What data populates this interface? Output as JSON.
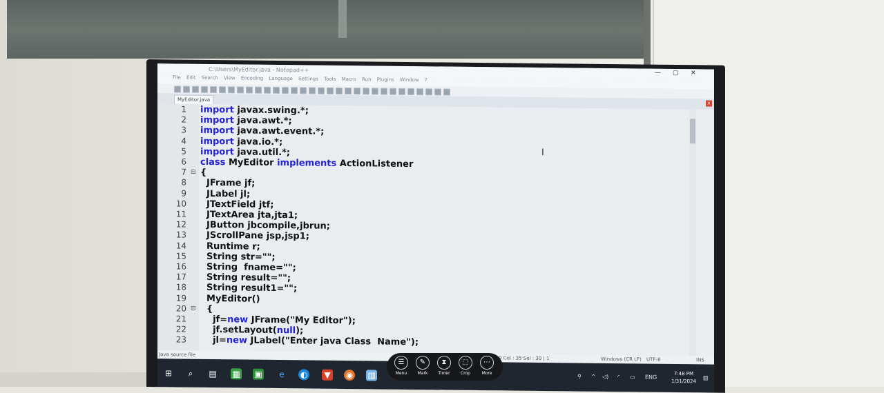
{
  "window": {
    "title": "C:\\Users\\MyEditor.java - Notepad++",
    "controls": [
      "—",
      "▢",
      "✕"
    ]
  },
  "menu": [
    "File",
    "Edit",
    "Search",
    "View",
    "Encoding",
    "Language",
    "Settings",
    "Tools",
    "Macro",
    "Run",
    "Plugins",
    "Window",
    "?"
  ],
  "tab": {
    "label": "MyEditor.java",
    "close": "x"
  },
  "editor": {
    "lines": [
      {
        "n": "1",
        "kw": "import",
        "rest": " javax.swing.*;"
      },
      {
        "n": "2",
        "kw": "import",
        "rest": " java.awt.*;"
      },
      {
        "n": "3",
        "kw": "import",
        "rest": " java.awt.event.*;"
      },
      {
        "n": "4",
        "kw": "import",
        "rest": " java.io.*;"
      },
      {
        "n": "5",
        "kw": "import",
        "rest": " java.util.*;"
      },
      {
        "n": "6",
        "kw": "class",
        "rest": " MyEditor ",
        "kw2": "implements",
        "rest2": " ActionListener"
      },
      {
        "n": "7",
        "kw": "",
        "rest": "{"
      },
      {
        "n": "8",
        "kw": "",
        "rest": "  JFrame jf;"
      },
      {
        "n": "9",
        "kw": "",
        "rest": "  JLabel jl;"
      },
      {
        "n": "10",
        "kw": "",
        "rest": "  JTextField jtf;"
      },
      {
        "n": "11",
        "kw": "",
        "rest": "  JTextArea jta,jta1;"
      },
      {
        "n": "12",
        "kw": "",
        "rest": "  JButton jbcompile,jbrun;"
      },
      {
        "n": "13",
        "kw": "",
        "rest": "  JScrollPane jsp,jsp1;"
      },
      {
        "n": "14",
        "kw": "",
        "rest": "  Runtime r;"
      },
      {
        "n": "15",
        "kw": "",
        "rest": "  String str=\"\";"
      },
      {
        "n": "16",
        "kw": "",
        "rest": "  String  fname=\"\";"
      },
      {
        "n": "17",
        "kw": "",
        "rest": "  String result=\"\";"
      },
      {
        "n": "18",
        "kw": "",
        "rest": "  String result1=\"\";"
      },
      {
        "n": "19",
        "kw": "",
        "rest": "  MyEditor()"
      },
      {
        "n": "20",
        "kw": "",
        "rest": "  {"
      },
      {
        "n": "21",
        "pre": "    jf=",
        "kw": "new",
        "rest": " JFrame(\"My Editor\");"
      },
      {
        "n": "22",
        "pre": "    jf.setLayout(",
        "kw": "null",
        "rest": ");"
      },
      {
        "n": "23",
        "pre": "    jl=",
        "kw": "new",
        "rest": " JLabel(\"Enter java Class  Name\");"
      }
    ]
  },
  "status": {
    "filetype": "Java source file",
    "position": "Ln : 149   Col : 35   Sel : 30 | 1",
    "eol": "Windows (CR LF)",
    "encoding": "UTF-8",
    "mode": "INS"
  },
  "taskbar": {
    "lang": "ENG",
    "time": "7:48 PM",
    "date": "1/31/2024"
  },
  "overlay": [
    {
      "icon": "☰",
      "label": "Menu"
    },
    {
      "icon": "✎",
      "label": "Mark"
    },
    {
      "icon": "⧗",
      "label": "Timer"
    },
    {
      "icon": "⬚",
      "label": "Crop"
    },
    {
      "icon": "⋯",
      "label": "More"
    }
  ]
}
